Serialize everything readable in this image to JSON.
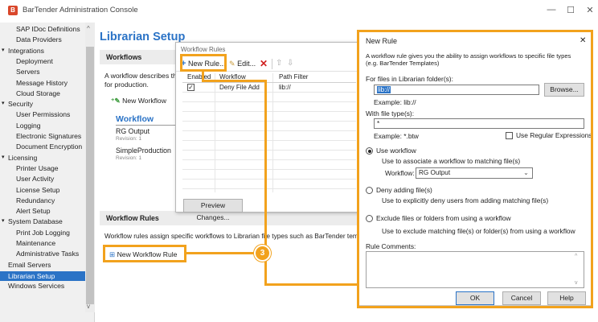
{
  "window": {
    "title": "BarTender Administration Console",
    "controls": {
      "minimize": "—",
      "maximize": "☐",
      "close": "✕"
    }
  },
  "sidebar": {
    "items": [
      {
        "label": "SAP IDoc Definitions",
        "indent": 2
      },
      {
        "label": "Data Providers",
        "indent": 2
      },
      {
        "label": "Integrations",
        "indent": 1,
        "expander": "▾"
      },
      {
        "label": "Deployment",
        "indent": 2
      },
      {
        "label": "Servers",
        "indent": 2
      },
      {
        "label": "Message History",
        "indent": 2
      },
      {
        "label": "Cloud Storage",
        "indent": 2
      },
      {
        "label": "Security",
        "indent": 1,
        "expander": "▾"
      },
      {
        "label": "User Permissions",
        "indent": 2
      },
      {
        "label": "Logging",
        "indent": 2
      },
      {
        "label": "Electronic Signatures",
        "indent": 2
      },
      {
        "label": "Document Encryption",
        "indent": 2
      },
      {
        "label": "Licensing",
        "indent": 1,
        "expander": "▾"
      },
      {
        "label": "Printer Usage",
        "indent": 2
      },
      {
        "label": "User Activity",
        "indent": 2
      },
      {
        "label": "License Setup",
        "indent": 2
      },
      {
        "label": "Redundancy",
        "indent": 2
      },
      {
        "label": "Alert Setup",
        "indent": 2
      },
      {
        "label": "System Database",
        "indent": 1,
        "expander": "▾"
      },
      {
        "label": "Print Job Logging",
        "indent": 2
      },
      {
        "label": "Maintenance",
        "indent": 2
      },
      {
        "label": "Administrative Tasks",
        "indent": 2
      },
      {
        "label": "Email Servers",
        "indent": 1
      },
      {
        "label": "Librarian Setup",
        "indent": 1,
        "selected": true
      },
      {
        "label": "Windows Services",
        "indent": 1
      }
    ],
    "scroll_up": "^",
    "scroll_down": "v"
  },
  "main": {
    "title": "Librarian Setup",
    "workflows_header": "Workflows",
    "workflows_desc_line1": "A workflow describes the l",
    "workflows_desc_line2": "for production.",
    "new_workflow_label": "New Workflow",
    "workflow_list_header": "Workflow",
    "workflows": [
      {
        "name": "RG Output",
        "revision": "Revision: 1"
      },
      {
        "name": "SimpleProduction",
        "revision": "Revision: 1"
      }
    ],
    "workflow_rules_header": "Workflow Rules",
    "workflow_rules_desc": "Workflow rules assign specific workflows to Librarian file types such as BarTender template de",
    "new_workflow_rule_label": "New Workflow Rule"
  },
  "workflow_rules_dialog": {
    "title": "Workflow Rules",
    "toolbar": {
      "new_rule": "New Rule...",
      "edit": "Edit..."
    },
    "columns": [
      "Enabled",
      "Workflow",
      "Path Filter"
    ],
    "rows": [
      {
        "enabled": true,
        "workflow": "Deny File Add",
        "path_filter": "lib://"
      }
    ],
    "preview_button": "Preview Changes..."
  },
  "new_rule_dialog": {
    "title": "New Rule",
    "close": "✕",
    "description_line1": "A workflow rule gives you the ability to assign workflows to specific file types",
    "description_line2": "(e.g. BarTender Templates)",
    "folder_label": "For files in Librarian folder(s):",
    "folder_value": "lib://",
    "browse_button": "Browse...",
    "folder_example": "Example: lib://",
    "filetype_label": "With file type(s):",
    "filetype_value": "*",
    "filetype_example": "Example: *.btw",
    "regex_label": "Use Regular Expressions",
    "regex_checked": false,
    "option_use_workflow": "Use workflow",
    "option_use_workflow_desc": "Use to associate a workflow to matching file(s)",
    "workflow_label": "Workflow:",
    "workflow_selected": "RG Output",
    "option_deny": "Deny adding file(s)",
    "option_deny_desc": "Use to explicitly deny users from adding matching file(s)",
    "option_exclude": "Exclude files or folders from using a workflow",
    "option_exclude_desc": "Use to exclude matching file(s) or folder(s) from using a workflow",
    "selected_option": "use_workflow",
    "comments_label": "Rule Comments:",
    "comments_value": "",
    "ok_button": "OK",
    "cancel_button": "Cancel",
    "help_button": "Help"
  },
  "annotation": {
    "step_number": "3",
    "color": "#f2a21d"
  },
  "colors": {
    "accent": "#2b73c6",
    "selection": "#2b73c6",
    "annotation": "#f2a21d"
  }
}
